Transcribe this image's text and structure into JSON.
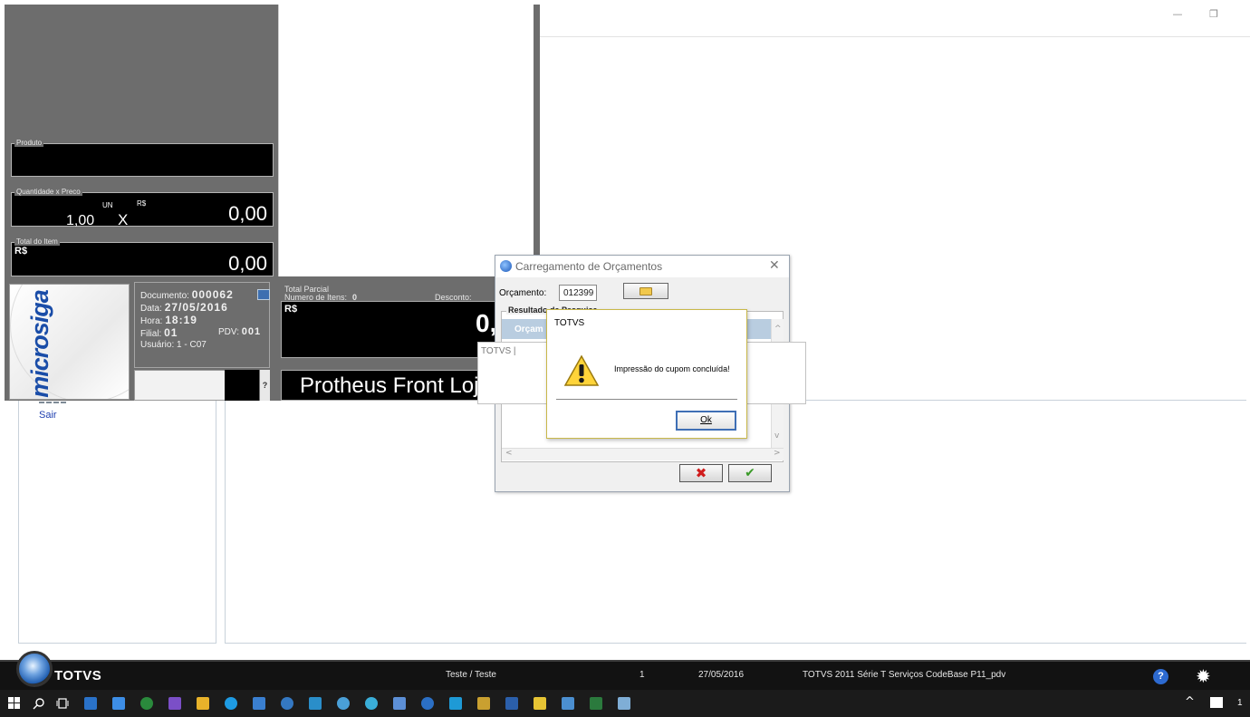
{
  "window": {
    "minimize_glyph": "—",
    "restore_glyph": "❐"
  },
  "left_panel": {
    "sair_label": "Sair"
  },
  "pos": {
    "produto_legend": "Produto",
    "qty_legend": "Quantidade x Preco",
    "qty_value": "1,00",
    "qty_unit": "UN",
    "qty_times": "X",
    "qty_currency": "R$",
    "qty_price": "0,00",
    "total_legend": "Total do Item",
    "total_currency": "R$",
    "total_value": "0,00",
    "logo_text": "microsiga",
    "documento_label": "Documento:",
    "documento_value": "000062",
    "data_label": "Data:",
    "data_value": "27/05/2016",
    "hora_label": "Hora:",
    "hora_value": "18:19",
    "filial_label": "Filial:",
    "filial_value": "01",
    "pdv_label": "PDV:",
    "pdv_value": "001",
    "usuario_label": "Usuário:",
    "usuario_value": "1 - C07",
    "help_glyph": "?",
    "partial_legend": "Total Parcial",
    "itens_label": "Numero de Itens:",
    "itens_value": "0",
    "desconto_label": "Desconto:",
    "partial_currency": "R$",
    "partial_value": "0,",
    "front_title": "Protheus Front Loja"
  },
  "orc_dialog": {
    "title": "Carregamento de Orçamentos",
    "close_glyph": "✕",
    "orcamento_label": "Orçamento:",
    "orcamento_value": "012399",
    "group_label": "Resultado da Pesquisa",
    "header_partial": "Orçam",
    "cancel_glyph": "✖",
    "ok_glyph": "✔",
    "scroll_up": "^",
    "scroll_down": "v",
    "scroll_left": "<",
    "scroll_right": ">"
  },
  "totvs_strip": {
    "label": "TOTVS |"
  },
  "message_box": {
    "title": "TOTVS",
    "text": "Impressão do cupom concluída!",
    "ok_label": "Ok"
  },
  "status_bar": {
    "logo_text": "TOTVS",
    "user": "Teste / Teste",
    "count": "1",
    "date": "27/05/2016",
    "environment": "TOTVS 2011 Série T Serviços CodeBase P11_pdv",
    "help_glyph": "?",
    "gear_glyph": "✹"
  },
  "taskbar": {
    "tray_chevron": "^",
    "clock_partial": "1"
  },
  "colors": {
    "pos_background": "#6d6d6d",
    "display_background": "#000000",
    "accent_blue": "#1a4da8",
    "status_bar": "#121212",
    "taskbar": "#1b1b1b"
  }
}
